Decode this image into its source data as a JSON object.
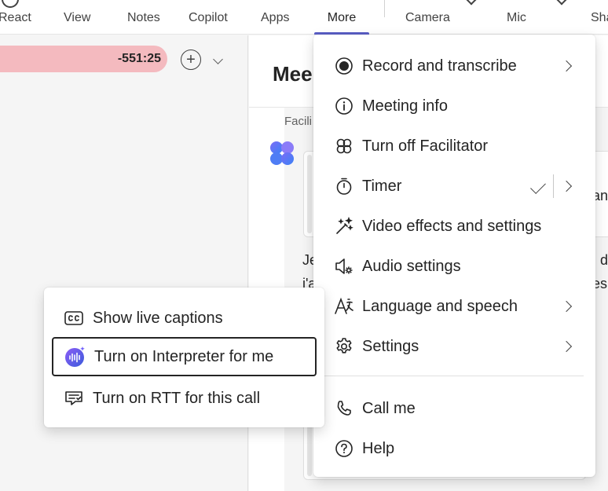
{
  "toolbar": {
    "items": [
      {
        "label": "React"
      },
      {
        "label": "View"
      },
      {
        "label": "Notes"
      },
      {
        "label": "Copilot"
      },
      {
        "label": "Apps"
      },
      {
        "label": "More"
      },
      {
        "label": "Camera"
      },
      {
        "label": "Mic"
      },
      {
        "label": "Sha"
      }
    ],
    "active_color": "#5b5fc7"
  },
  "left_pane": {
    "timer_value": "-551:25",
    "timer_color": "#f4babf",
    "add_icon": "plus-circle-icon",
    "dropdown_icon": "chevron-down-icon"
  },
  "chat": {
    "title": "Mee",
    "facilitator_label": "Facili",
    "line_a": "an",
    "line_b_left": "Je",
    "line_b_right": "d",
    "line_c_left": "i'a",
    "line_c_right": "es"
  },
  "more_menu": {
    "items": [
      {
        "label": "Record and transcribe",
        "icon": "record-icon",
        "submenu": true
      },
      {
        "label": "Meeting info",
        "icon": "info-icon",
        "submenu": false
      },
      {
        "label": "Turn off Facilitator",
        "icon": "facilitator-icon",
        "submenu": false
      },
      {
        "label": "Timer",
        "icon": "timer-icon",
        "submenu": true,
        "checked": true
      },
      {
        "label": "Video effects and settings",
        "icon": "magic-wand-icon",
        "submenu": false
      },
      {
        "label": "Audio settings",
        "icon": "speaker-settings-icon",
        "submenu": false
      },
      {
        "label": "Language and speech",
        "icon": "language-icon",
        "submenu": true
      },
      {
        "label": "Settings",
        "icon": "gear-icon",
        "submenu": true
      },
      {
        "label": "Call me",
        "icon": "phone-icon",
        "submenu": false
      },
      {
        "label": "Help",
        "icon": "help-icon",
        "submenu": false
      }
    ]
  },
  "language_submenu": {
    "items": [
      {
        "label": "Show live captions",
        "icon": "closed-captions-icon"
      },
      {
        "label": "Turn on Interpreter for me",
        "icon": "interpreter-icon",
        "focused": true
      },
      {
        "label": "Turn on RTT for this call",
        "icon": "rtt-icon"
      }
    ]
  }
}
